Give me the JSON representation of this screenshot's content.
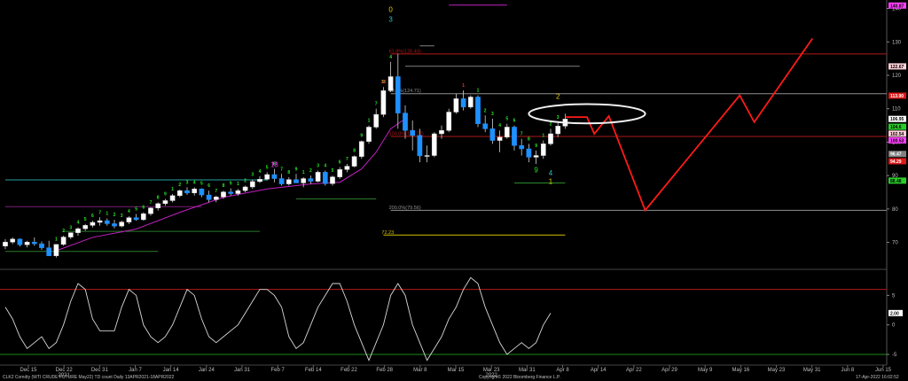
{
  "chart_data": {
    "type": "candlestick",
    "title": "CLK2 Comdty (WTI CRUDE FUTURE May22) TD count Daily 13APR2021-18APR2022",
    "copyright": "Copyright© 2022 Bloomberg Finance L.P.",
    "timestamp": "17-Apr-2022 16:02:52",
    "price_axis": {
      "ylim": [
        63,
        142
      ],
      "ticks": [
        70,
        80,
        90,
        100,
        110,
        120,
        130,
        140
      ]
    },
    "osc_axis": {
      "ylim": [
        -6.5,
        8.5
      ],
      "ticks": [
        -5,
        0,
        5
      ],
      "upper_line": 6,
      "lower_line": -5,
      "last_value": "2.00"
    },
    "x_axis": {
      "dates": [
        "Dec 15",
        "Dec 22",
        "Dec 31",
        "Jan 7",
        "Jan 14",
        "Jan 24",
        "Jan 31",
        "Feb 7",
        "Feb 14",
        "Feb 22",
        "Feb 28",
        "Mar 8",
        "Mar 15",
        "Mar 23",
        "Mar 31",
        "Apr 8",
        "Apr 14",
        "Apr 22",
        "Apr 29",
        "May 9",
        "May 16",
        "May 23",
        "May 31",
        "Jun 8",
        "Jun 15"
      ],
      "year_labels": [
        {
          "date": "Dec 22",
          "text": "2021"
        },
        {
          "date": "Mar 23",
          "text": "2022"
        }
      ]
    },
    "candles": [
      [
        68.9,
        71.0,
        68.0,
        70.1
      ],
      [
        70.1,
        71.5,
        69.5,
        71.0
      ],
      [
        71.0,
        71.2,
        68.8,
        69.3
      ],
      [
        69.3,
        70.5,
        68.5,
        70.1
      ],
      [
        70.1,
        71.5,
        69.0,
        69.6
      ],
      [
        69.6,
        70.3,
        67.8,
        68.4
      ],
      [
        68.4,
        70.5,
        67.0,
        66.0
      ],
      [
        66.0,
        69.5,
        65.5,
        69.4
      ],
      [
        69.4,
        72.0,
        69.0,
        71.6
      ],
      [
        71.6,
        73.0,
        71.0,
        72.9
      ],
      [
        72.9,
        74.5,
        72.0,
        74.1
      ],
      [
        74.1,
        75.5,
        73.5,
        75.1
      ],
      [
        75.1,
        76.5,
        74.5,
        76.0
      ],
      [
        76.0,
        77.5,
        75.0,
        76.5
      ],
      [
        76.5,
        77.2,
        75.0,
        75.6
      ],
      [
        75.6,
        76.8,
        74.2,
        74.9
      ],
      [
        74.9,
        76.5,
        74.5,
        76.1
      ],
      [
        76.1,
        77.8,
        75.5,
        77.4
      ],
      [
        77.4,
        78.5,
        76.5,
        76.8
      ],
      [
        76.8,
        79.0,
        76.5,
        78.6
      ],
      [
        78.6,
        80.5,
        78.0,
        80.3
      ],
      [
        80.3,
        82.0,
        79.5,
        81.6
      ],
      [
        81.6,
        83.0,
        81.0,
        82.5
      ],
      [
        82.5,
        84.5,
        82.0,
        84.0
      ],
      [
        84.0,
        85.8,
        83.5,
        85.5
      ],
      [
        85.5,
        86.5,
        84.2,
        84.8
      ],
      [
        84.8,
        86.5,
        84.0,
        86.0
      ],
      [
        86.0,
        86.2,
        83.5,
        84.2
      ],
      [
        84.2,
        85.5,
        82.0,
        82.8
      ],
      [
        82.8,
        84.0,
        82.0,
        83.6
      ],
      [
        83.6,
        85.5,
        83.0,
        85.1
      ],
      [
        85.1,
        86.2,
        84.0,
        84.6
      ],
      [
        84.6,
        86.0,
        84.0,
        85.5
      ],
      [
        85.5,
        87.0,
        85.0,
        86.6
      ],
      [
        86.6,
        88.8,
        86.0,
        88.2
      ],
      [
        88.2,
        89.8,
        87.8,
        88.9
      ],
      [
        88.9,
        91.0,
        88.5,
        90.3
      ],
      [
        90.3,
        92.0,
        88.0,
        89.1
      ],
      [
        89.1,
        90.5,
        87.0,
        87.5
      ],
      [
        87.5,
        89.5,
        87.0,
        88.8
      ],
      [
        88.8,
        90.5,
        88.0,
        87.8
      ],
      [
        87.8,
        89.5,
        86.5,
        89.1
      ],
      [
        89.1,
        90.0,
        87.5,
        88.3
      ],
      [
        88.3,
        91.5,
        88.0,
        91.0
      ],
      [
        91.0,
        91.5,
        87.0,
        87.6
      ],
      [
        87.6,
        90.0,
        87.0,
        89.6
      ],
      [
        89.6,
        92.5,
        89.0,
        91.8
      ],
      [
        91.8,
        93.5,
        91.0,
        92.8
      ],
      [
        92.8,
        96.0,
        92.5,
        95.7
      ],
      [
        95.7,
        100.5,
        95.0,
        100.2
      ],
      [
        100.2,
        105.0,
        99.5,
        104.5
      ],
      [
        104.5,
        110.0,
        104.0,
        108.3
      ],
      [
        108.3,
        116.5,
        107.5,
        115.4
      ],
      [
        115.4,
        124.0,
        115.0,
        119.6
      ],
      [
        119.6,
        126.5,
        104.0,
        108.7
      ],
      [
        108.7,
        111.0,
        101.0,
        103.5
      ],
      [
        103.5,
        106.5,
        97.5,
        102.0
      ],
      [
        102.0,
        104.0,
        94.0,
        95.9
      ],
      [
        95.9,
        99.0,
        94.0,
        96.0
      ],
      [
        96.0,
        103.0,
        95.5,
        102.5
      ],
      [
        102.5,
        105.0,
        101.0,
        103.5
      ],
      [
        103.5,
        110.0,
        103.0,
        109.0
      ],
      [
        109.0,
        114.5,
        108.5,
        113.0
      ],
      [
        113.0,
        115.5,
        109.5,
        110.5
      ],
      [
        110.5,
        114.0,
        110.0,
        113.5
      ],
      [
        113.5,
        114.0,
        104.5,
        105.5
      ],
      [
        105.5,
        108.0,
        103.0,
        104.0
      ],
      [
        104.0,
        107.0,
        99.5,
        100.5
      ],
      [
        100.5,
        103.5,
        97.0,
        101.5
      ],
      [
        101.5,
        105.5,
        101.0,
        104.5
      ],
      [
        104.5,
        105.0,
        97.5,
        99.0
      ],
      [
        99.0,
        101.0,
        96.0,
        98.0
      ],
      [
        98.0,
        99.5,
        94.0,
        95.5
      ],
      [
        95.5,
        97.5,
        93.5,
        96.0
      ],
      [
        96.0,
        100.5,
        95.0,
        99.5
      ],
      [
        99.5,
        104.0,
        99.0,
        102.5
      ],
      [
        102.5,
        106.0,
        101.5,
        104.8
      ],
      [
        104.8,
        108.5,
        104.0,
        106.9
      ]
    ],
    "td_counts": [
      {
        "i": 7,
        "t": "1",
        "c": "green"
      },
      {
        "i": 8,
        "t": "2",
        "c": "green"
      },
      {
        "i": 9,
        "t": "3",
        "c": "green"
      },
      {
        "i": 10,
        "t": "4",
        "c": "green"
      },
      {
        "i": 11,
        "t": "5",
        "c": "green"
      },
      {
        "i": 12,
        "t": "6",
        "c": "green"
      },
      {
        "i": 13,
        "t": "7",
        "c": "green"
      },
      {
        "i": 14,
        "t": "1",
        "c": "green"
      },
      {
        "i": 15,
        "t": "2",
        "c": "green"
      },
      {
        "i": 16,
        "t": "3",
        "c": "green"
      },
      {
        "i": 17,
        "t": "4",
        "c": "green"
      },
      {
        "i": 18,
        "t": "5",
        "c": "green"
      },
      {
        "i": 19,
        "t": "6",
        "c": "green"
      },
      {
        "i": 20,
        "t": "7",
        "c": "green"
      },
      {
        "i": 21,
        "t": "8",
        "c": "green"
      },
      {
        "i": 22,
        "t": "9",
        "c": "green"
      },
      {
        "i": 23,
        "t": "1",
        "c": "green"
      },
      {
        "i": 24,
        "t": "2",
        "c": "green"
      },
      {
        "i": 25,
        "t": "3",
        "c": "green"
      },
      {
        "i": 26,
        "t": "4",
        "c": "green"
      },
      {
        "i": 27,
        "t": "5",
        "c": "green"
      },
      {
        "i": 28,
        "t": "6",
        "c": "green"
      },
      {
        "i": 29,
        "t": "7",
        "c": "green"
      },
      {
        "i": 30,
        "t": "8",
        "c": "green"
      },
      {
        "i": 31,
        "t": "9",
        "c": "green"
      },
      {
        "i": 32,
        "t": "1",
        "c": "green"
      },
      {
        "i": 33,
        "t": "2",
        "c": "green"
      },
      {
        "i": 34,
        "t": "3",
        "c": "green"
      },
      {
        "i": 35,
        "t": "4",
        "c": "green"
      },
      {
        "i": 36,
        "t": "5",
        "c": "green"
      },
      {
        "i": 37,
        "t": "6",
        "c": "green"
      },
      {
        "i": 38,
        "t": "7",
        "c": "green"
      },
      {
        "i": 39,
        "t": "8",
        "c": "green"
      },
      {
        "i": 40,
        "t": "9",
        "c": "green"
      },
      {
        "i": 41,
        "t": "1",
        "c": "green"
      },
      {
        "i": 42,
        "t": "2",
        "c": "green"
      },
      {
        "i": 43,
        "t": "3",
        "c": "green"
      },
      {
        "i": 44,
        "t": "4",
        "c": "green"
      },
      {
        "i": 45,
        "t": "5",
        "c": "green"
      },
      {
        "i": 46,
        "t": "6",
        "c": "green"
      },
      {
        "i": 47,
        "t": "7",
        "c": "green"
      },
      {
        "i": 48,
        "t": "8",
        "c": "green"
      },
      {
        "i": 49,
        "t": "9",
        "c": "green"
      },
      {
        "i": 50,
        "t": "1",
        "c": "green"
      },
      {
        "i": 51,
        "t": "7",
        "c": "green"
      },
      {
        "i": 52,
        "t": "9",
        "c": "green"
      },
      {
        "i": 53,
        "t": "4",
        "c": "green"
      },
      {
        "i": 65,
        "t": "1",
        "c": "green"
      },
      {
        "i": 66,
        "t": "2",
        "c": "green"
      },
      {
        "i": 67,
        "t": "3",
        "c": "green"
      },
      {
        "i": 68,
        "t": "4",
        "c": "green"
      },
      {
        "i": 69,
        "t": "5",
        "c": "green"
      },
      {
        "i": 70,
        "t": "6",
        "c": "green"
      },
      {
        "i": 71,
        "t": "7",
        "c": "green"
      },
      {
        "i": 72,
        "t": "8",
        "c": "green"
      },
      {
        "i": 73,
        "t": "9",
        "c": "green"
      },
      {
        "i": 52,
        "t": "13",
        "c": "red",
        "pos": "high"
      },
      {
        "i": 63,
        "t": "1",
        "c": "red",
        "pos": "high"
      },
      {
        "i": 37,
        "t": "13",
        "c": "magenta",
        "pos": "high"
      },
      {
        "i": 74,
        "t": "1",
        "c": "green",
        "pos": "high"
      },
      {
        "i": 75,
        "t": "2",
        "c": "green",
        "pos": "high"
      },
      {
        "i": 76,
        "t": "3",
        "c": "green",
        "pos": "high"
      }
    ],
    "annotations": [
      {
        "text": "0",
        "date_index": 53,
        "price": 139,
        "color": "#e6d000"
      },
      {
        "text": "3",
        "date_index": 53,
        "price": 136,
        "color": "#29c6c6"
      },
      {
        "text": "2",
        "date_index": 76,
        "price": 113,
        "color": "#e6d000"
      },
      {
        "text": "9",
        "date_index": 73,
        "price": 91,
        "color": "#29e629"
      },
      {
        "text": "4",
        "date_index": 75,
        "price": 90,
        "color": "#29c6c6"
      },
      {
        "text": "1",
        "date_index": 75,
        "price": 87.5,
        "color": "#e6d000"
      },
      {
        "text": "13",
        "date_index": 37,
        "price": 92.5,
        "color": "#d040d0"
      }
    ],
    "levels": [
      {
        "label": "",
        "value": 141,
        "x0": 61,
        "x1": 69,
        "color": "#c020c0"
      },
      {
        "label": "",
        "value": 128.8,
        "x0": 57,
        "x1": 59,
        "color": "#808080"
      },
      {
        "label": "61.8%(126.43)",
        "value": 126.4,
        "x0": 53,
        "x1": 125,
        "color": "#b01818"
      },
      {
        "label": "",
        "value": 122.7,
        "x0": 55,
        "x1": 79,
        "color": "#808080"
      },
      {
        "label": "50.0%(124.71)",
        "value": 114.5,
        "x0": 53,
        "x1": 125,
        "color": "#909090"
      },
      {
        "label": "100.0%(101.72)",
        "value": 101.7,
        "x0": 53,
        "x1": 125,
        "color": "#b01818"
      },
      {
        "label": "",
        "value": 87.8,
        "x0": 70,
        "x1": 77,
        "color": "#2a8a2a"
      },
      {
        "label": "",
        "value": 88.7,
        "x0": 0,
        "x1": 36,
        "color": "#29a0a0"
      },
      {
        "label": "",
        "value": 83.0,
        "x0": 40,
        "x1": 51,
        "color": "#2a7a2a"
      },
      {
        "label": "",
        "value": 80.7,
        "x0": 0,
        "x1": 27,
        "color": "#7a207a"
      },
      {
        "label": "200.0%(79.56)",
        "value": 79.6,
        "x0": 53,
        "x1": 125,
        "color": "#909090"
      },
      {
        "label": "",
        "value": 73.3,
        "x0": 8,
        "x1": 35,
        "color": "#2a7a2a"
      },
      {
        "label": "72.23",
        "value": 72.2,
        "x0": 52,
        "x1": 77,
        "color": "#d0c000"
      },
      {
        "label": "",
        "value": 67.3,
        "x0": 0,
        "x1": 21,
        "color": "#2a7a2a"
      }
    ],
    "forecast_path": [
      [
        77,
        107.5
      ],
      [
        80,
        107.5
      ],
      [
        81,
        102.5
      ],
      [
        83,
        107.8
      ],
      [
        88,
        79.6
      ],
      [
        101,
        114
      ],
      [
        103,
        106
      ],
      [
        111,
        131
      ]
    ],
    "ellipse": {
      "center_index": 80,
      "center_price": 108.5,
      "rx_days": 8,
      "ry_price": 1.6,
      "color": "#f0f0f0"
    },
    "right_labels": [
      {
        "value": 140.87,
        "text": "140.87",
        "bg": "#ff40ff",
        "fg": "#000"
      },
      {
        "value": 122.67,
        "text": "122.67",
        "bg": "#ffd0d8",
        "fg": "#000"
      },
      {
        "value": 113.9,
        "text": "113.90",
        "bg": "#e01818",
        "fg": "#fff"
      },
      {
        "value": 106.95,
        "text": "106.95",
        "bg": "#ffffff",
        "fg": "#000"
      },
      {
        "value": 104.6,
        "text": "104.6",
        "bg": "#29cc29",
        "fg": "#000"
      },
      {
        "value": 102.54,
        "text": "102.54",
        "bg": "#ffd0d8",
        "fg": "#000"
      },
      {
        "value": 100.53,
        "text": "100.53",
        "bg": "#ff40ff",
        "fg": "#000"
      },
      {
        "value": 96.47,
        "text": "96.47",
        "bg": "#808080",
        "fg": "#fff"
      },
      {
        "value": 94.29,
        "text": "94.29",
        "bg": "#e01818",
        "fg": "#fff"
      },
      {
        "value": 88.48,
        "text": "88.48",
        "bg": "#29cc29",
        "fg": "#000"
      }
    ],
    "moving_average": [
      {
        "i": 7,
        "v": 67.5
      },
      {
        "i": 12,
        "v": 71.5
      },
      {
        "i": 18,
        "v": 74
      },
      {
        "i": 24,
        "v": 79
      },
      {
        "i": 30,
        "v": 83.5
      },
      {
        "i": 36,
        "v": 86
      },
      {
        "i": 42,
        "v": 87.5
      },
      {
        "i": 46,
        "v": 88
      },
      {
        "i": 49,
        "v": 92
      },
      {
        "i": 51,
        "v": 97
      },
      {
        "i": 53,
        "v": 104
      },
      {
        "i": 55,
        "v": 107
      }
    ],
    "oscillator": [
      3,
      1,
      -2,
      -4,
      -3,
      -2,
      -4,
      -3,
      0,
      4,
      7,
      6,
      1,
      -1,
      -1,
      -1,
      3,
      6,
      5,
      0,
      -2,
      -3,
      -2,
      0,
      3,
      6,
      5,
      1,
      -2,
      -3,
      -2,
      -1,
      0,
      2,
      4,
      6,
      6,
      5,
      3,
      -2,
      -4,
      -3,
      0,
      3,
      5,
      7,
      7,
      4,
      0,
      -3,
      -6,
      -3,
      0,
      5,
      7,
      5,
      0,
      -3,
      -6,
      -4,
      -2,
      1,
      3,
      6,
      8,
      7,
      3,
      0,
      -3,
      -5,
      -4,
      -3,
      -4,
      -3,
      0,
      2
    ]
  }
}
